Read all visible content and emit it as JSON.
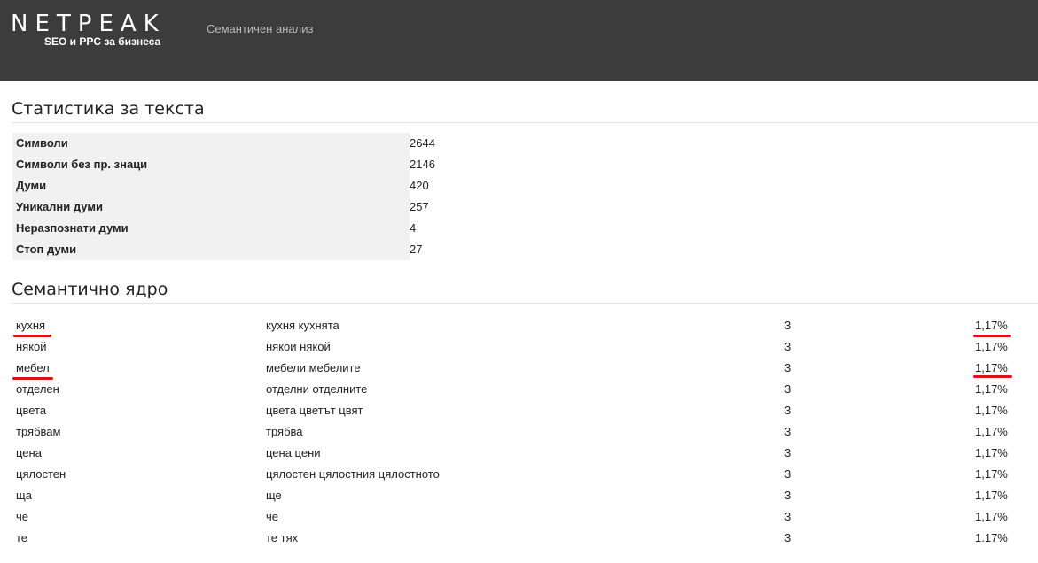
{
  "header": {
    "logo_word": "NETPEAK",
    "logo_tagline": "SEO и PPC за бизнеса",
    "title": "Семантичен анализ",
    "background": "#3c3c3c"
  },
  "stats": {
    "title": "Статистика за текста",
    "rows": [
      {
        "label": "Символи",
        "value": "2644"
      },
      {
        "label": "Символи без пр. знаци",
        "value": "2146"
      },
      {
        "label": "Думи",
        "value": "420"
      },
      {
        "label": "Уникални думи",
        "value": "257"
      },
      {
        "label": "Неразпознати думи",
        "value": "4"
      },
      {
        "label": "Стоп думи",
        "value": "27"
      }
    ]
  },
  "core": {
    "title": "Семантично ядро",
    "rows": [
      {
        "word": "кухня",
        "forms": "кухня кухнята",
        "count": "3",
        "percent": "1,17%"
      },
      {
        "word": "някой",
        "forms": "някои някой",
        "count": "3",
        "percent": "1,17%"
      },
      {
        "word": "мебел",
        "forms": "мебели мебелите",
        "count": "3",
        "percent": "1,17%"
      },
      {
        "word": "отделен",
        "forms": "отделни отделните",
        "count": "3",
        "percent": "1,17%"
      },
      {
        "word": "цвета",
        "forms": "цвета цветът цвят",
        "count": "3",
        "percent": "1,17%"
      },
      {
        "word": "трябвам",
        "forms": "трябва",
        "count": "3",
        "percent": "1,17%"
      },
      {
        "word": "цена",
        "forms": "цена цени",
        "count": "3",
        "percent": "1,17%"
      },
      {
        "word": "цялостен",
        "forms": "цялостен цялостния цялостното",
        "count": "3",
        "percent": "1,17%"
      },
      {
        "word": "ща",
        "forms": "ще",
        "count": "3",
        "percent": "1,17%"
      },
      {
        "word": "че",
        "forms": "че",
        "count": "3",
        "percent": "1,17%"
      },
      {
        "word": "те",
        "forms": "те тях",
        "count": "3",
        "percent": "1.17%"
      }
    ]
  },
  "highlight_color": "#d7141a"
}
